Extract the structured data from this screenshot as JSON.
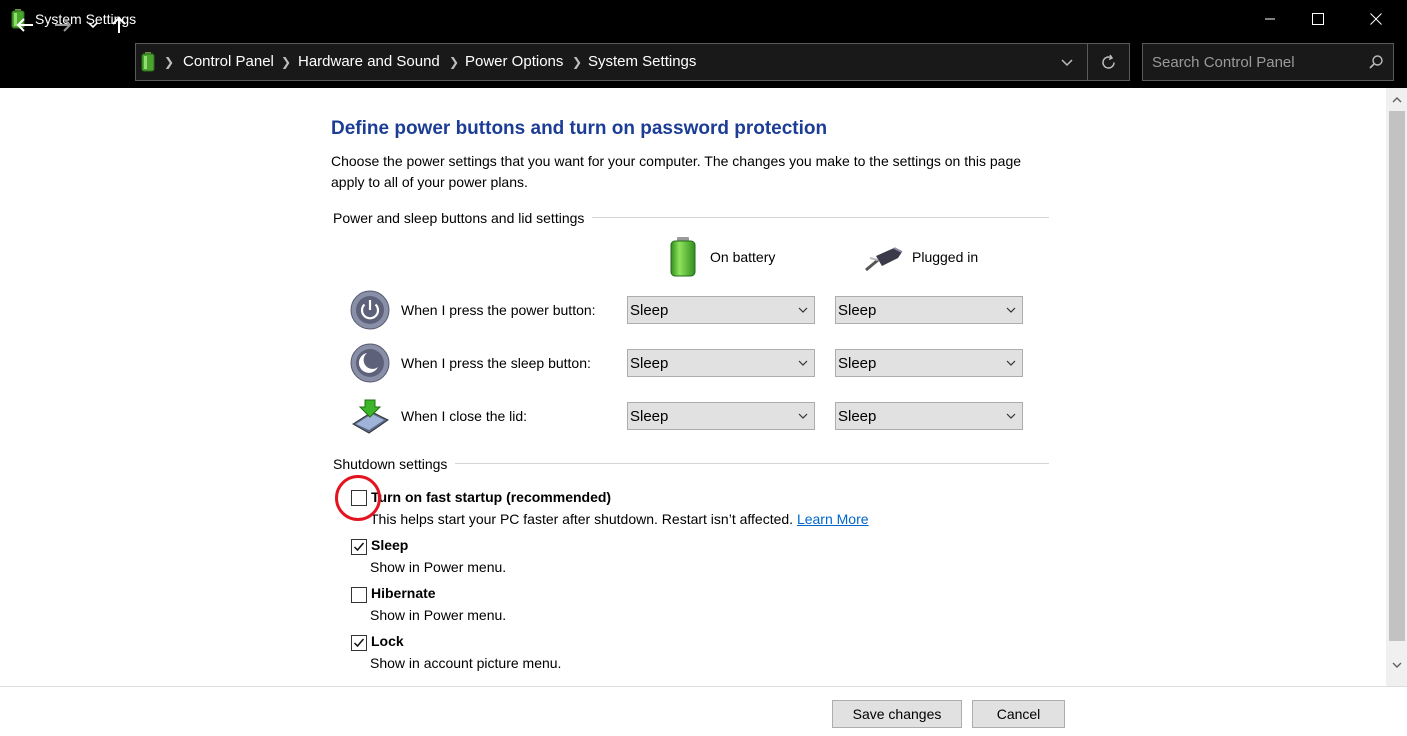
{
  "window": {
    "title": "System Settings",
    "app_icon": "battery-icon"
  },
  "nav": {
    "back_icon": "arrow-left-icon",
    "forward_icon": "arrow-right-icon",
    "recent_icon": "chevron-down-icon",
    "up_icon": "arrow-up-icon",
    "breadcrumbs": [
      "Control Panel",
      "Hardware and Sound",
      "Power Options",
      "System Settings"
    ],
    "search_placeholder": "Search Control Panel"
  },
  "page": {
    "title": "Define power buttons and turn on password protection",
    "description": "Choose the power settings that you want for your computer. The changes you make to the settings on this page apply to all of your power plans."
  },
  "power_section": {
    "title": "Power and sleep buttons and lid settings",
    "columns": [
      "On battery",
      "Plugged in"
    ],
    "rows": [
      {
        "label": "When I press the power button:",
        "icon": "power-button-icon",
        "on_battery": "Sleep",
        "plugged_in": "Sleep"
      },
      {
        "label": "When I press the sleep button:",
        "icon": "sleep-button-icon",
        "on_battery": "Sleep",
        "plugged_in": "Sleep"
      },
      {
        "label": "When I close the lid:",
        "icon": "laptop-lid-icon",
        "on_battery": "Sleep",
        "plugged_in": "Sleep"
      }
    ]
  },
  "shutdown_section": {
    "title": "Shutdown settings",
    "items": [
      {
        "label": "Turn on fast startup (recommended)",
        "description": "This helps start your PC faster after shutdown. Restart isn’t affected.",
        "link": "Learn More",
        "checked": false
      },
      {
        "label": "Sleep",
        "description": "Show in Power menu.",
        "checked": true
      },
      {
        "label": "Hibernate",
        "description": "Show in Power menu.",
        "checked": false
      },
      {
        "label": "Lock",
        "description": "Show in account picture menu.",
        "checked": true
      }
    ]
  },
  "footer": {
    "save_label": "Save changes",
    "cancel_label": "Cancel"
  },
  "colors": {
    "title_blue": "#1c3d96",
    "link_blue": "#0066cc",
    "highlight_red": "#e3141f"
  }
}
